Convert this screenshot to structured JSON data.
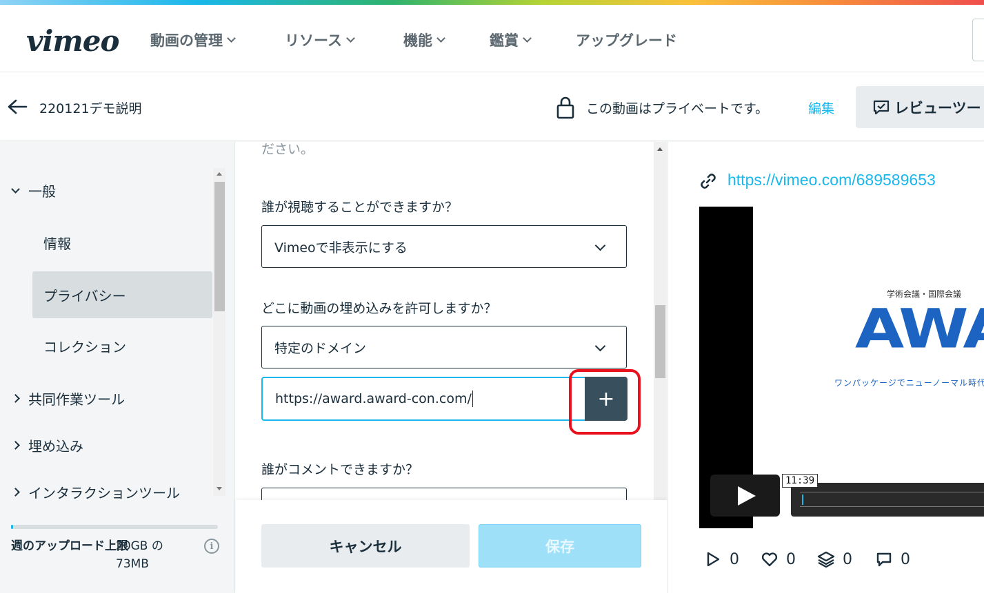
{
  "topnav": {
    "logo": "vimeo",
    "items": [
      {
        "label": "動画の管理",
        "has_dropdown": true
      },
      {
        "label": "リソース",
        "has_dropdown": true
      },
      {
        "label": "機能",
        "has_dropdown": true
      },
      {
        "label": "鑑賞",
        "has_dropdown": true
      },
      {
        "label": "アップグレード",
        "has_dropdown": false
      }
    ]
  },
  "subheader": {
    "video_title": "220121デモ説明",
    "privacy_status": "この動画はプライベートです。",
    "edit_link": "編集",
    "review_tool_button": "レビューツー"
  },
  "sidebar": {
    "sections": [
      {
        "label": "一般",
        "expanded": true,
        "children": [
          "情報",
          "プライバシー",
          "コレクション"
        ],
        "active_child": "プライバシー"
      },
      {
        "label": "共同作業ツール",
        "expanded": false
      },
      {
        "label": "埋め込み",
        "expanded": false
      },
      {
        "label": "インタラクションツール",
        "expanded": false
      }
    ],
    "upload_limit": {
      "label": "週のアップロード上限",
      "amount": "20GB の 73MB",
      "used_fraction": 0.004
    }
  },
  "form": {
    "truncated_text": "ださい。",
    "who_can_watch": {
      "label": "誰が視聴することができますか？",
      "value": "Vimeoで非表示にする"
    },
    "embed": {
      "label": "どこに動画の埋め込みを許可しますか？",
      "value": "特定のドメイン"
    },
    "domain_input": {
      "value": "https://award.award-con.com/",
      "add_button": "+"
    },
    "who_can_comment": {
      "label": "誰がコメントできますか？"
    }
  },
  "footer": {
    "cancel_label": "キャンセル",
    "save_label": "保存",
    "save_enabled": false
  },
  "preview": {
    "url": "https://vimeo.com/689589653",
    "slide": {
      "subtitle": "学術会議・国際会議",
      "logo_text": "AWA",
      "tagline": "ワンパッケージでニューノーマル時代の"
    },
    "duration": "11:39",
    "stats": {
      "plays": "0",
      "likes": "0",
      "collections": "0",
      "comments": "0"
    }
  },
  "colors": {
    "accent": "#1ab7ea",
    "text": "#1a2e3b",
    "plus_button": "#38505e",
    "highlight": "#e8121f"
  }
}
